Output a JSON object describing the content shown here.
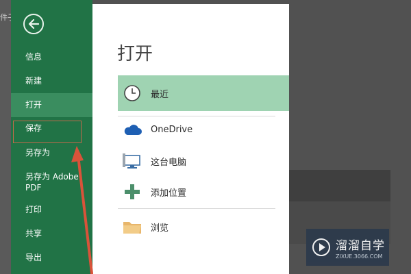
{
  "background": {
    "left_text": "件子"
  },
  "sidebar": {
    "items": [
      {
        "label": "信息"
      },
      {
        "label": "新建"
      },
      {
        "label": "打开"
      },
      {
        "label": "保存"
      },
      {
        "label": "另存为"
      },
      {
        "label": "另存为 Adobe PDF"
      },
      {
        "label": "打印"
      },
      {
        "label": "共享"
      },
      {
        "label": "导出"
      }
    ],
    "active_item": "打开"
  },
  "main": {
    "title": "打开",
    "locations": [
      {
        "label": "最近",
        "icon": "clock-icon",
        "selected": true
      },
      {
        "label": "OneDrive",
        "icon": "cloud-icon"
      },
      {
        "label": "这台电脑",
        "icon": "computer-icon"
      },
      {
        "label": "添加位置",
        "icon": "plus-icon"
      },
      {
        "label": "浏览",
        "icon": "folder-icon"
      }
    ]
  },
  "watermark": {
    "title": "溜溜自学",
    "subtitle": "ZIXUE.3066.COM"
  },
  "colors": {
    "sidebar_green": "#217346",
    "selected_green": "#9fd3b2",
    "annotation_red": "#d9533a"
  }
}
